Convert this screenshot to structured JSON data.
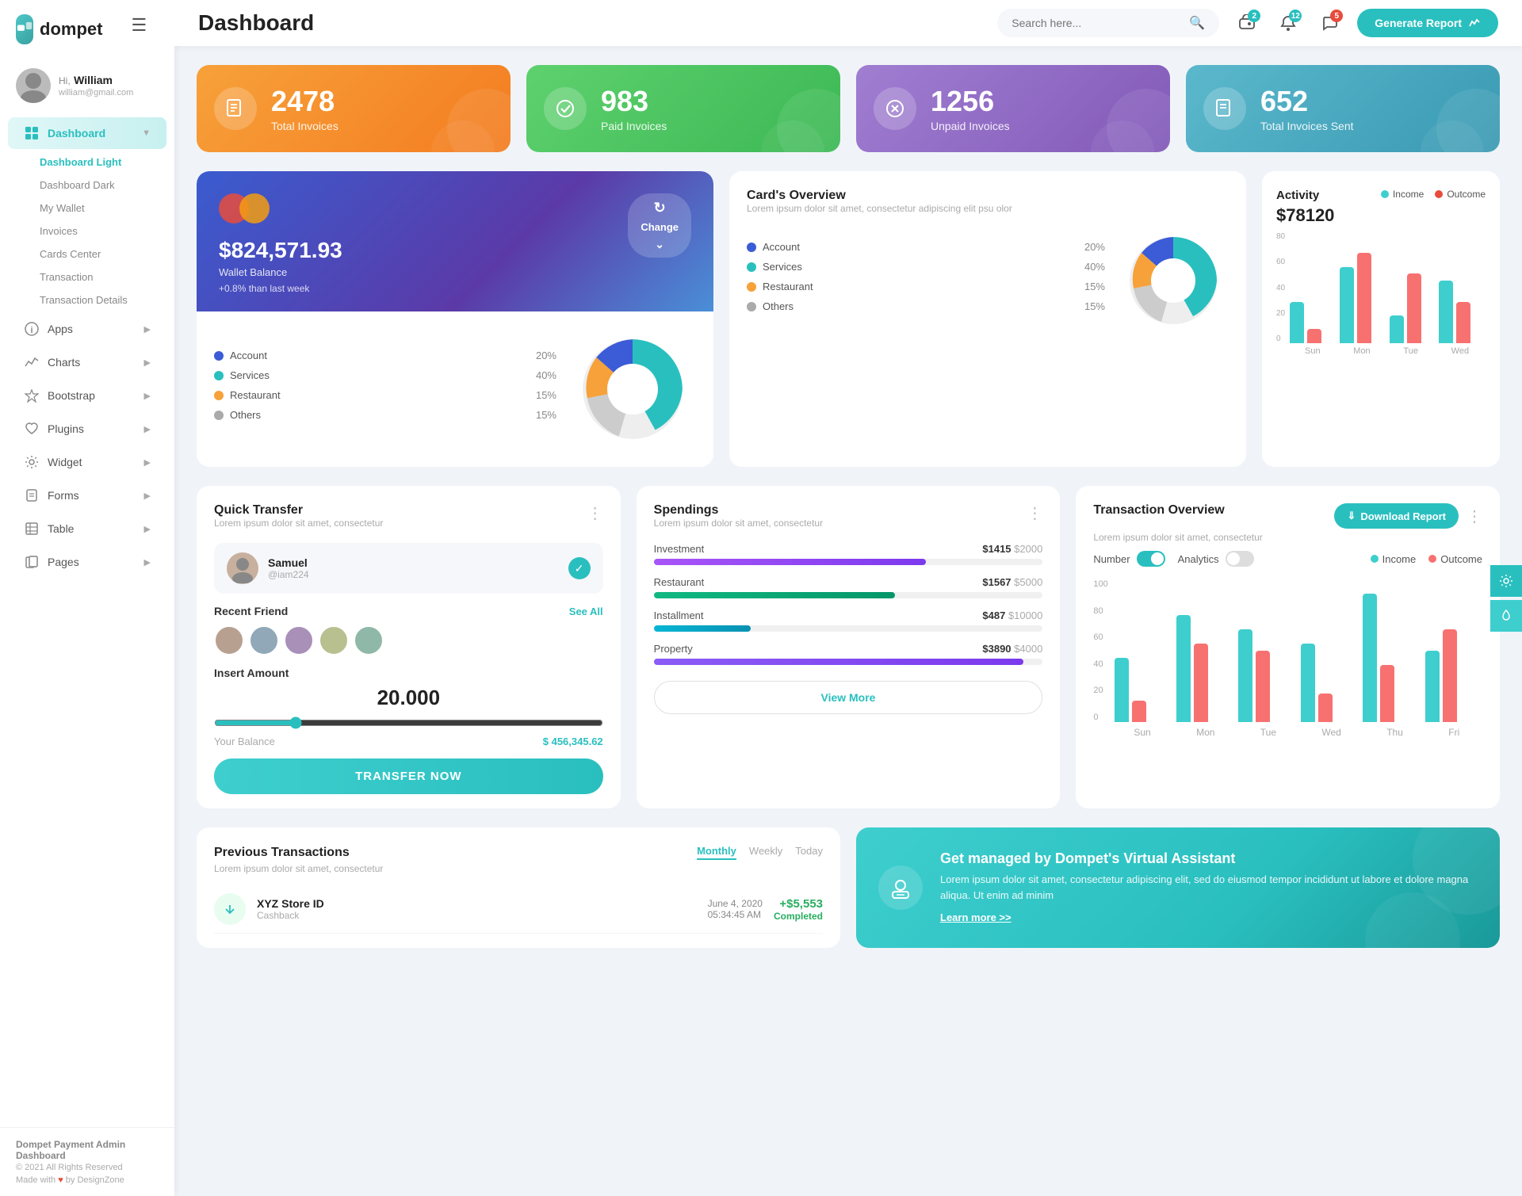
{
  "sidebar": {
    "logo_text": "dompet",
    "user": {
      "greeting": "Hi,",
      "name": "William",
      "email": "william@gmail.com"
    },
    "nav": [
      {
        "id": "dashboard",
        "label": "Dashboard",
        "icon": "grid",
        "active": true,
        "hasArrow": true
      },
      {
        "id": "apps",
        "label": "Apps",
        "icon": "circle-i",
        "active": false,
        "hasArrow": true
      },
      {
        "id": "charts",
        "label": "Charts",
        "icon": "activity",
        "active": false,
        "hasArrow": true
      },
      {
        "id": "bootstrap",
        "label": "Bootstrap",
        "icon": "star",
        "active": false,
        "hasArrow": true
      },
      {
        "id": "plugins",
        "label": "Plugins",
        "icon": "heart",
        "active": false,
        "hasArrow": true
      },
      {
        "id": "widget",
        "label": "Widget",
        "icon": "gear",
        "active": false,
        "hasArrow": true
      },
      {
        "id": "forms",
        "label": "Forms",
        "icon": "file",
        "active": false,
        "hasArrow": true
      },
      {
        "id": "table",
        "label": "Table",
        "icon": "table",
        "active": false,
        "hasArrow": true
      },
      {
        "id": "pages",
        "label": "Pages",
        "icon": "pages",
        "active": false,
        "hasArrow": true
      }
    ],
    "sub_nav": [
      {
        "label": "Dashboard Light",
        "active": true
      },
      {
        "label": "Dashboard Dark",
        "active": false
      },
      {
        "label": "My Wallet",
        "active": false
      },
      {
        "label": "Invoices",
        "active": false
      },
      {
        "label": "Cards Center",
        "active": false
      },
      {
        "label": "Transaction",
        "active": false
      },
      {
        "label": "Transaction Details",
        "active": false
      }
    ],
    "footer": {
      "title": "Dompet Payment Admin Dashboard",
      "copy": "© 2021 All Rights Reserved",
      "credit": "Made with ♥ by DesignZone"
    }
  },
  "header": {
    "title": "Dashboard",
    "search_placeholder": "Search here...",
    "notifications": [
      {
        "icon": "wallet",
        "count": "2",
        "color": "teal"
      },
      {
        "icon": "bell",
        "count": "12",
        "color": "teal"
      },
      {
        "icon": "chat",
        "count": "5",
        "color": "red"
      }
    ],
    "generate_btn": "Generate Report"
  },
  "stats": [
    {
      "value": "2478",
      "label": "Total Invoices",
      "color": "orange",
      "icon": "invoice"
    },
    {
      "value": "983",
      "label": "Paid Invoices",
      "color": "green",
      "icon": "check"
    },
    {
      "value": "1256",
      "label": "Unpaid Invoices",
      "color": "purple",
      "icon": "x-circle"
    },
    {
      "value": "652",
      "label": "Total Invoices Sent",
      "color": "teal",
      "icon": "invoice2"
    }
  ],
  "wallet_card": {
    "balance": "$824,571.93",
    "label": "Wallet Balance",
    "change": "+0.8% than last week",
    "change_btn": "Change"
  },
  "card_overview": {
    "title": "Card's Overview",
    "subtitle": "Lorem ipsum dolor sit amet, consectetur adipiscing elit psu olor",
    "items": [
      {
        "label": "Account",
        "color": "#3b5cd6",
        "pct": "20%"
      },
      {
        "label": "Services",
        "color": "#2abfbf",
        "pct": "40%"
      },
      {
        "label": "Restaurant",
        "color": "#f7a13a",
        "pct": "15%"
      },
      {
        "label": "Others",
        "color": "#aaa",
        "pct": "15%"
      }
    ]
  },
  "activity": {
    "title": "Activity",
    "amount": "$78120",
    "legend": [
      {
        "label": "Income",
        "color": "#3ecece"
      },
      {
        "label": "Outcome",
        "color": "#e74c3c"
      }
    ],
    "y_axis": [
      "80",
      "60",
      "40",
      "20",
      "0"
    ],
    "x_axis": [
      "Sun",
      "Mon",
      "Tue",
      "Wed"
    ],
    "bars": [
      {
        "day": "Sun",
        "income": 30,
        "outcome": 10
      },
      {
        "day": "Mon",
        "income": 55,
        "outcome": 65
      },
      {
        "day": "Tue",
        "income": 20,
        "outcome": 50
      },
      {
        "day": "Wed",
        "income": 45,
        "outcome": 30
      }
    ]
  },
  "quick_transfer": {
    "title": "Quick Transfer",
    "subtitle": "Lorem ipsum dolor sit amet, consectetur",
    "contact": {
      "name": "Samuel",
      "handle": "@iam224"
    },
    "recent_friends_label": "Recent Friend",
    "see_all": "See All",
    "friends": [
      {
        "id": 1
      },
      {
        "id": 2
      },
      {
        "id": 3
      },
      {
        "id": 4
      },
      {
        "id": 5
      }
    ],
    "insert_amount_label": "Insert Amount",
    "amount": "20.000",
    "your_balance_label": "Your Balance",
    "balance_value": "$ 456,345.62",
    "transfer_btn": "TRANSFER NOW"
  },
  "spendings": {
    "title": "Spendings",
    "subtitle": "Lorem ipsum dolor sit amet, consectetur",
    "items": [
      {
        "label": "Investment",
        "amount": "$1415",
        "total": "$2000",
        "bar_class": "bar-investment",
        "width": "70%"
      },
      {
        "label": "Restaurant",
        "amount": "$1567",
        "total": "$5000",
        "bar_class": "bar-restaurant",
        "width": "62%"
      },
      {
        "label": "Installment",
        "amount": "$487",
        "total": "$10000",
        "bar_class": "bar-installment",
        "width": "25%"
      },
      {
        "label": "Property",
        "amount": "$3890",
        "total": "$4000",
        "bar_class": "bar-property",
        "width": "95%"
      }
    ],
    "view_more_btn": "View More"
  },
  "transaction_overview": {
    "title": "Transaction Overview",
    "subtitle": "Lorem ipsum dolor sit amet, consectetur",
    "download_btn": "Download Report",
    "toggles": [
      {
        "label": "Number",
        "active": true
      },
      {
        "label": "Analytics",
        "active": false
      }
    ],
    "legend": [
      {
        "label": "Income",
        "color": "#3ecece"
      },
      {
        "label": "Outcome",
        "color": "#f87171"
      }
    ],
    "y_axis": [
      "100",
      "80",
      "60",
      "40",
      "20",
      "0"
    ],
    "x_axis": [
      "Sun",
      "Mon",
      "Tue",
      "Wed",
      "Thu",
      "Fri"
    ],
    "bars": [
      {
        "day": "Sun",
        "income": 45,
        "outcome": 15
      },
      {
        "day": "Mon",
        "income": 75,
        "outcome": 55
      },
      {
        "day": "Tue",
        "income": 65,
        "outcome": 50
      },
      {
        "day": "Wed",
        "income": 55,
        "outcome": 20
      },
      {
        "day": "Thu",
        "income": 90,
        "outcome": 40
      },
      {
        "day": "Fri",
        "income": 50,
        "outcome": 65
      }
    ]
  },
  "previous_transactions": {
    "title": "Previous Transactions",
    "subtitle": "Lorem ipsum dolor sit amet, consectetur",
    "tabs": [
      "Monthly",
      "Weekly",
      "Today"
    ],
    "active_tab": "Monthly",
    "items": [
      {
        "name": "XYZ Store ID",
        "type": "Cashback",
        "date": "June 4, 2020",
        "time": "05:34:45 AM",
        "amount": "+$5,553",
        "status": "Completed",
        "icon_type": "download"
      }
    ]
  },
  "va_banner": {
    "title": "Get managed by Dompet's Virtual Assistant",
    "description": "Lorem ipsum dolor sit amet, consectetur adipiscing elit, sed do eiusmod tempor incididunt ut labore et dolore magna aliqua. Ut enim ad minim",
    "link": "Learn more >>"
  },
  "float_buttons": [
    {
      "icon": "gear",
      "id": "settings-float"
    },
    {
      "icon": "droplet",
      "id": "theme-float"
    }
  ]
}
